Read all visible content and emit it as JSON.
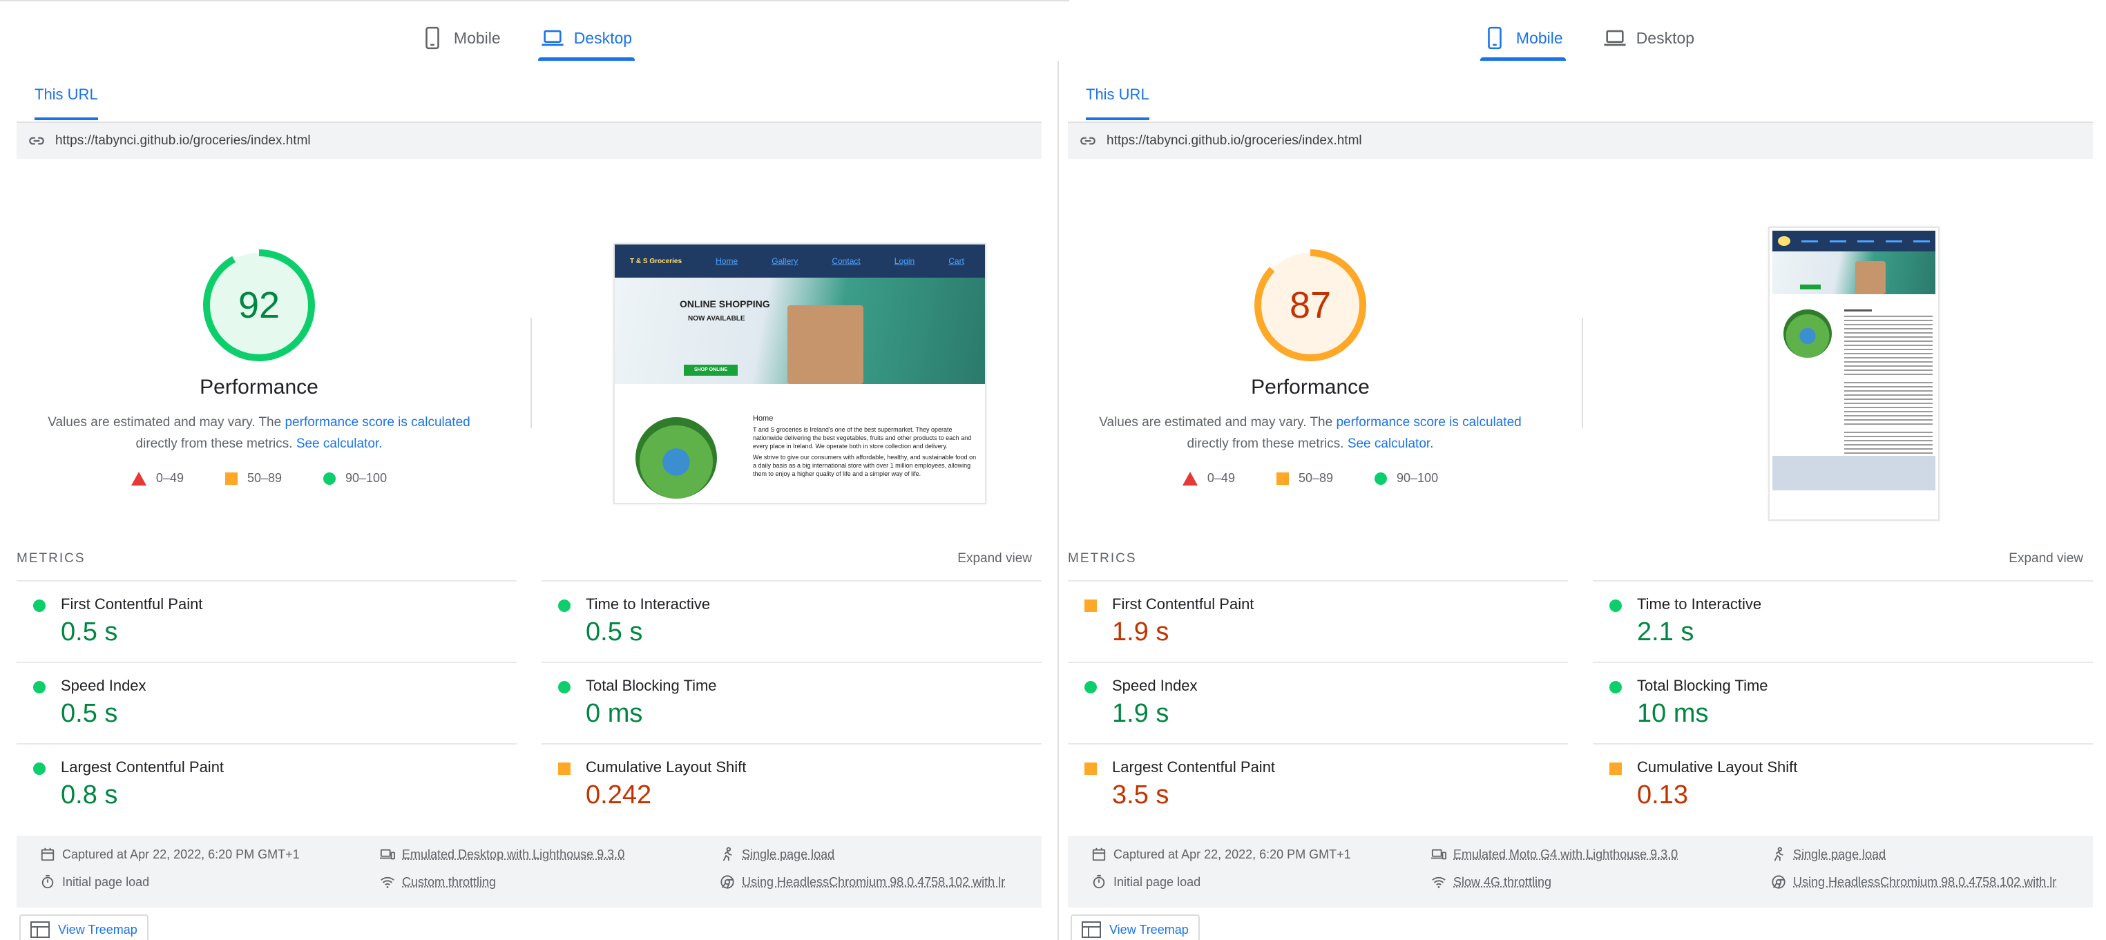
{
  "panels": [
    {
      "id": "desktop",
      "device_tabs": {
        "mobile": "Mobile",
        "desktop": "Desktop",
        "active": "desktop"
      },
      "url_tab": "This URL",
      "url": "https://tabynci.github.io/groceries/index.html",
      "score": {
        "value": "92",
        "fraction": 0.92,
        "label": "Performance",
        "color": "#0cce6b",
        "text_color": "#018642",
        "bg": "#e6f9ee"
      },
      "desc_prefix": "Values are estimated and may vary. The ",
      "desc_link": "performance score is calculated",
      "desc_mid": "directly from these metrics. ",
      "desc_link2": "See calculator.",
      "legend": [
        "0–49",
        "50–89",
        "90–100"
      ],
      "metrics_title": "METRICS",
      "expand": "Expand view",
      "metrics": [
        {
          "name": "First Contentful Paint",
          "value": "0.5 s",
          "status": "good"
        },
        {
          "name": "Time to Interactive",
          "value": "0.5 s",
          "status": "good"
        },
        {
          "name": "Speed Index",
          "value": "0.5 s",
          "status": "good"
        },
        {
          "name": "Total Blocking Time",
          "value": "0 ms",
          "status": "good"
        },
        {
          "name": "Largest Contentful Paint",
          "value": "0.8 s",
          "status": "good"
        },
        {
          "name": "Cumulative Layout Shift",
          "value": "0.242",
          "status": "avg"
        }
      ],
      "info": {
        "captured": "Captured at Apr 22, 2022, 6:20 PM GMT+1",
        "emulated": "Emulated Desktop with Lighthouse 9.3.0",
        "single": "Single page load",
        "initial": "Initial page load",
        "throttling": "Custom throttling",
        "browser": "Using HeadlessChromium 98.0.4758.102 with lr"
      },
      "treemap": "View Treemap",
      "site": {
        "brand": "T & S Groceries",
        "nav": [
          "Home",
          "Gallery",
          "Contact",
          "Login",
          "Cart"
        ],
        "hero_title": "ONLINE SHOPPING",
        "hero_sub": "NOW AVAILABLE",
        "hero_btn": "SHOP ONLINE",
        "heading": "Home",
        "p1": "T and S groceries is Ireland's one of the best supermarket. They operate nationwide delivering the best vegetables, fruits and other products to each and every place in Ireland. We operate both in store collection and delivery.",
        "p2": "We strive to give our consumers with affordable, healthy, and sustainable food on a daily basis as a big international store with over 1 million employees, allowing them to enjoy a higher quality of life and a simpler way of life."
      }
    },
    {
      "id": "mobile",
      "device_tabs": {
        "mobile": "Mobile",
        "desktop": "Desktop",
        "active": "mobile"
      },
      "url_tab": "This URL",
      "url": "https://tabynci.github.io/groceries/index.html",
      "score": {
        "value": "87",
        "fraction": 0.87,
        "label": "Performance",
        "color": "#ffa726",
        "text_color": "#c33300",
        "bg": "#fff4e6"
      },
      "desc_prefix": "Values are estimated and may vary. The ",
      "desc_link": "performance score is calculated",
      "desc_mid": "directly from these metrics. ",
      "desc_link2": "See calculator.",
      "legend": [
        "0–49",
        "50–89",
        "90–100"
      ],
      "metrics_title": "METRICS",
      "expand": "Expand view",
      "metrics": [
        {
          "name": "First Contentful Paint",
          "value": "1.9 s",
          "status": "avg"
        },
        {
          "name": "Time to Interactive",
          "value": "2.1 s",
          "status": "good"
        },
        {
          "name": "Speed Index",
          "value": "1.9 s",
          "status": "good"
        },
        {
          "name": "Total Blocking Time",
          "value": "10 ms",
          "status": "good"
        },
        {
          "name": "Largest Contentful Paint",
          "value": "3.5 s",
          "status": "avg"
        },
        {
          "name": "Cumulative Layout Shift",
          "value": "0.13",
          "status": "avg"
        }
      ],
      "info": {
        "captured": "Captured at Apr 22, 2022, 6:20 PM GMT+1",
        "emulated": "Emulated Moto G4 with Lighthouse 9.3.0",
        "single": "Single page load",
        "initial": "Initial page load",
        "throttling": "Slow 4G throttling",
        "browser": "Using HeadlessChromium 98.0.4758.102 with lr"
      },
      "treemap": "View Treemap"
    }
  ]
}
